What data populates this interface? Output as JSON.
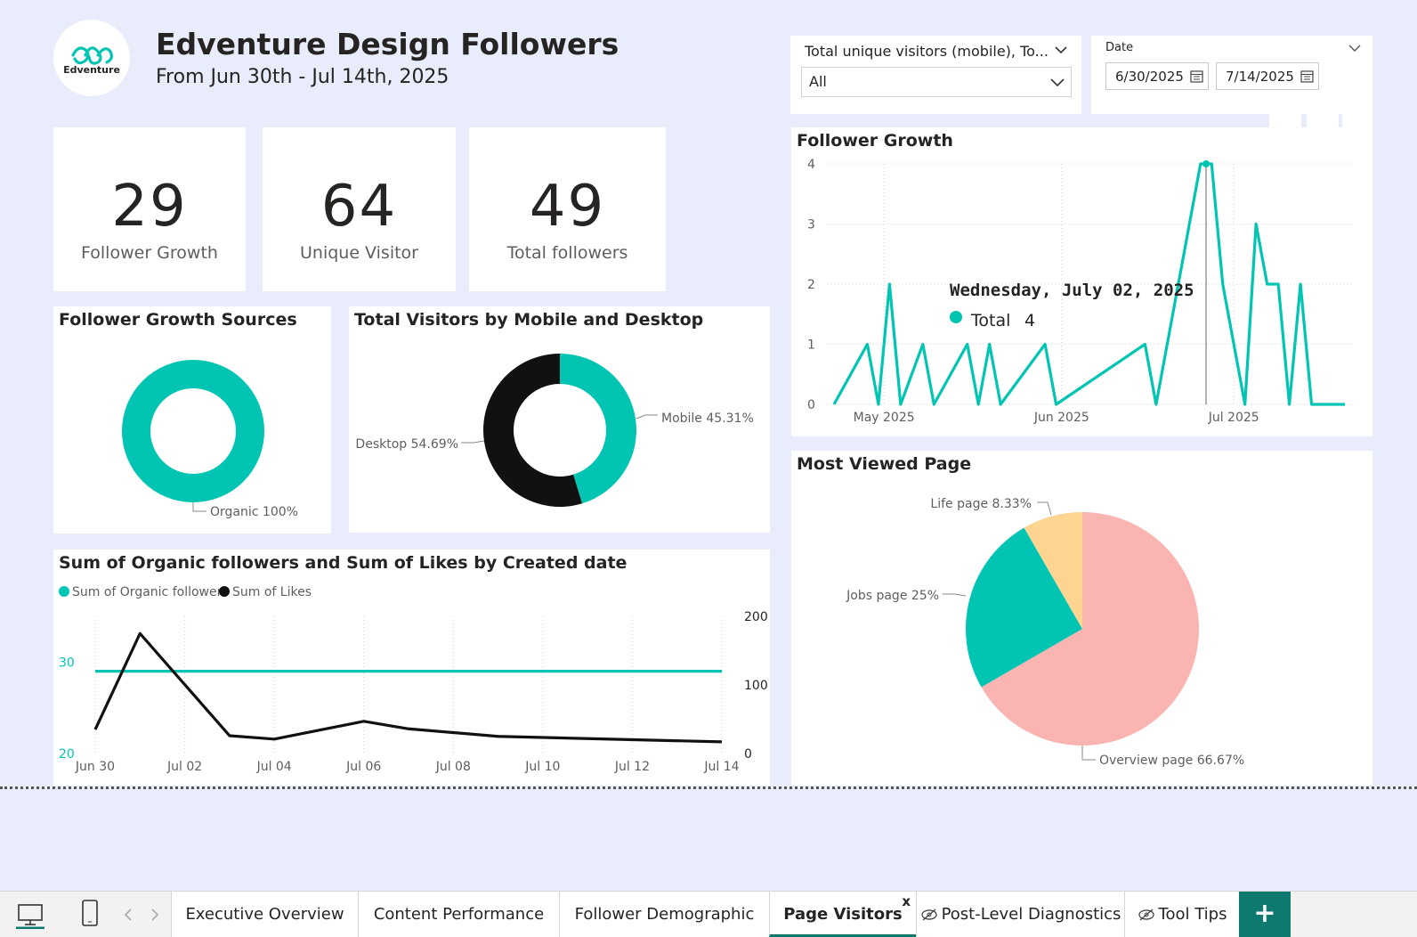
{
  "header": {
    "logo_text": "Edventure",
    "title": "Edventure Design Followers",
    "subtitle": "From Jun 30th - Jul 14th, 2025"
  },
  "slicers": {
    "visitor_type": {
      "title": "Total unique visitors (mobile), To...",
      "value": "All"
    },
    "date": {
      "title": "Date",
      "start": "6/30/2025",
      "end": "7/14/2025"
    }
  },
  "kpis": [
    {
      "value": "29",
      "label": "Follower Growth"
    },
    {
      "value": "64",
      "label": "Unique Visitor"
    },
    {
      "value": "49",
      "label": "Total followers"
    }
  ],
  "colors": {
    "teal": "#01c5b2",
    "black": "#111111",
    "pink": "#fab4b1",
    "yellow": "#fdd590",
    "background": "#e8ecfb"
  },
  "cards": {
    "sources_title": "Follower Growth Sources",
    "visitors_title": "Total Visitors by Mobile and Desktop",
    "combo_title": "Sum of Organic followers and Sum of Likes by Created date",
    "growth_title": "Follower Growth",
    "pages_title": "Most Viewed Page"
  },
  "tooltip": {
    "date": "Wednesday, July 02, 2025",
    "series": "Total",
    "value": "4"
  },
  "tabs": {
    "t1": "Executive Overview",
    "t2": "Content Performance",
    "t3": "Follower Demographic",
    "t4": "Page Visitors",
    "t5": "Post-Level Diagnostics",
    "t6": "Tool Tips",
    "close": "x",
    "add": "+"
  },
  "chart_data": [
    {
      "type": "pie",
      "title": "Follower Growth Sources",
      "donut": true,
      "slices": [
        {
          "label": "Organic",
          "value": 100,
          "color": "#01c5b2",
          "label_text": "Organic 100%"
        }
      ]
    },
    {
      "type": "pie",
      "title": "Total Visitors by Mobile and Desktop",
      "donut": true,
      "slices": [
        {
          "label": "Mobile",
          "value": 45.31,
          "color": "#01c5b2",
          "label_text": "Mobile 45.31%"
        },
        {
          "label": "Desktop",
          "value": 54.69,
          "color": "#111111",
          "label_text": "Desktop 54.69%"
        }
      ]
    },
    {
      "type": "line",
      "title": "Sum of Organic followers and Sum of Likes by Created date",
      "legend": [
        "Sum of Organic followers",
        "Sum of Likes"
      ],
      "legend_position": "top-left",
      "x": [
        "Jun 30",
        "Jul 01",
        "Jul 02",
        "Jul 03",
        "Jul 04",
        "Jul 05",
        "Jul 06",
        "Jul 07",
        "Jul 08",
        "Jul 09",
        "Jul 10",
        "Jul 11",
        "Jul 12",
        "Jul 13",
        "Jul 14"
      ],
      "x_ticks": [
        "Jun 30",
        "Jul 02",
        "Jul 04",
        "Jul 06",
        "Jul 08",
        "Jul 10",
        "Jul 12",
        "Jul 14"
      ],
      "series": [
        {
          "name": "Sum of Organic followers",
          "axis": "left",
          "color": "#01c5b2",
          "values": [
            29,
            29,
            29,
            29,
            29,
            29,
            29,
            29,
            29,
            29,
            29,
            29,
            29,
            29,
            29
          ]
        },
        {
          "name": "Sum of Likes",
          "axis": "right",
          "color": "#111111",
          "values": [
            35,
            175,
            null,
            26,
            21,
            null,
            47,
            36,
            null,
            25,
            null,
            null,
            null,
            null,
            17
          ]
        }
      ],
      "y_left": {
        "range": [
          20,
          35
        ],
        "ticks": [
          "20",
          "30"
        ]
      },
      "y_right": {
        "range": [
          0,
          200
        ],
        "ticks": [
          "0",
          "100",
          "200"
        ]
      },
      "grid": true
    },
    {
      "type": "line",
      "title": "Follower Growth",
      "series": [
        {
          "name": "Total",
          "color": "#01c5b2",
          "points": [
            [
              0,
              0
            ],
            [
              3,
              1
            ],
            [
              4,
              0
            ],
            [
              5,
              2
            ],
            [
              6,
              0
            ],
            [
              8,
              1
            ],
            [
              9,
              0
            ],
            [
              12,
              1
            ],
            [
              13,
              0
            ],
            [
              14,
              1
            ],
            [
              15,
              0
            ],
            [
              19,
              1
            ],
            [
              20,
              0
            ],
            [
              28,
              1
            ],
            [
              29,
              0
            ],
            [
              33,
              4
            ],
            [
              34,
              4
            ],
            [
              35,
              2
            ],
            [
              37,
              0
            ],
            [
              38,
              3
            ],
            [
              39,
              2
            ],
            [
              40,
              2
            ],
            [
              41,
              0
            ],
            [
              42,
              2
            ],
            [
              43,
              0
            ],
            [
              46,
              0
            ]
          ]
        }
      ],
      "x_ticks": [
        "May 2025",
        "Jun 2025",
        "Jul 2025"
      ],
      "y_ticks": [
        "0",
        "1",
        "2",
        "3",
        "4"
      ],
      "ylim": [
        0,
        4
      ],
      "grid": true
    },
    {
      "type": "pie",
      "title": "Most Viewed Page",
      "slices": [
        {
          "label": "Overview page",
          "value": 66.67,
          "color": "#fab4b1",
          "label_text": "Overview page 66.67%"
        },
        {
          "label": "Jobs page",
          "value": 25,
          "color": "#01c5b2",
          "label_text": "Jobs page 25%"
        },
        {
          "label": "Life page",
          "value": 8.33,
          "color": "#fdd590",
          "label_text": "Life page 8.33%"
        }
      ]
    }
  ]
}
